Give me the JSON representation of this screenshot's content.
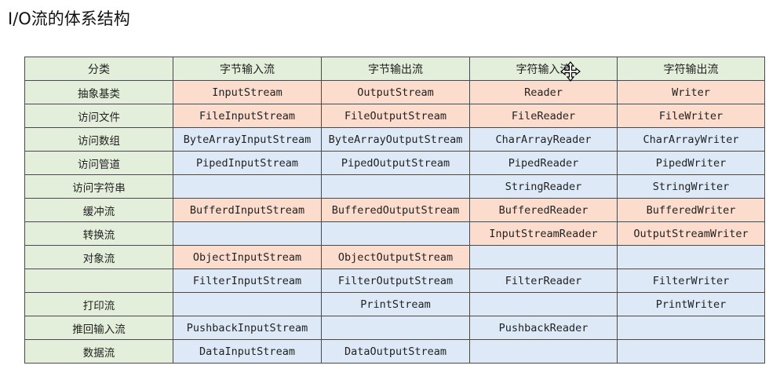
{
  "page": {
    "title": "I/O流的体系结构"
  },
  "colors": {
    "header_bg": "#e4efdb",
    "category_bg": "#e4efdb",
    "peach": "#fbdccd",
    "blue": "#dde9f6",
    "border": "#4a4a4a"
  },
  "table": {
    "headers": [
      "分类",
      "字节输入流",
      "字节输出流",
      "字符输入流",
      "字符输出流"
    ],
    "rows": [
      {
        "category": "抽象基类",
        "cells": [
          "InputStream",
          "OutputStream",
          "Reader",
          "Writer"
        ],
        "colors": [
          "peach",
          "peach",
          "peach",
          "peach"
        ]
      },
      {
        "category": "访问文件",
        "cells": [
          "FileInputStream",
          "FileOutputStream",
          "FileReader",
          "FileWriter"
        ],
        "colors": [
          "peach",
          "peach",
          "peach",
          "peach"
        ]
      },
      {
        "category": "访问数组",
        "cells": [
          "ByteArrayInputStream",
          "ByteArrayOutputStream",
          "CharArrayReader",
          "CharArrayWriter"
        ],
        "colors": [
          "blue",
          "blue",
          "blue",
          "blue"
        ]
      },
      {
        "category": "访问管道",
        "cells": [
          "PipedInputStream",
          "PipedOutputStream",
          "PipedReader",
          "PipedWriter"
        ],
        "colors": [
          "blue",
          "blue",
          "blue",
          "blue"
        ]
      },
      {
        "category": "访问字符串",
        "cells": [
          "",
          "",
          "StringReader",
          "StringWriter"
        ],
        "colors": [
          "blue",
          "blue",
          "blue",
          "blue"
        ]
      },
      {
        "category": "缓冲流",
        "cells": [
          "BufferdInputStream",
          "BufferedOutputStream",
          "BufferedReader",
          "BufferedWriter"
        ],
        "colors": [
          "peach",
          "peach",
          "peach",
          "peach"
        ]
      },
      {
        "category": "转换流",
        "cells": [
          "",
          "",
          "InputStreamReader",
          "OutputStreamWriter"
        ],
        "colors": [
          "blue",
          "blue",
          "peach",
          "peach"
        ]
      },
      {
        "category": "对象流",
        "cells": [
          "ObjectInputStream",
          "ObjectOutputStream",
          "",
          ""
        ],
        "colors": [
          "peach",
          "peach",
          "blue",
          "blue"
        ]
      },
      {
        "category": "",
        "cells": [
          "FilterInputStream",
          "FilterOutputStream",
          "FilterReader",
          "FilterWriter"
        ],
        "colors": [
          "blue",
          "blue",
          "blue",
          "blue"
        ]
      },
      {
        "category": "打印流",
        "cells": [
          "",
          "PrintStream",
          "",
          "PrintWriter"
        ],
        "colors": [
          "blue",
          "blue",
          "blue",
          "blue"
        ]
      },
      {
        "category": "推回输入流",
        "cells": [
          "PushbackInputStream",
          "",
          "PushbackReader",
          ""
        ],
        "colors": [
          "blue",
          "blue",
          "blue",
          "blue"
        ]
      },
      {
        "category": "数据流",
        "cells": [
          "DataInputStream",
          "DataOutputStream",
          "",
          ""
        ],
        "colors": [
          "blue",
          "blue",
          "blue",
          "blue"
        ]
      }
    ]
  },
  "cursor": {
    "icon": "move-cursor-icon"
  }
}
